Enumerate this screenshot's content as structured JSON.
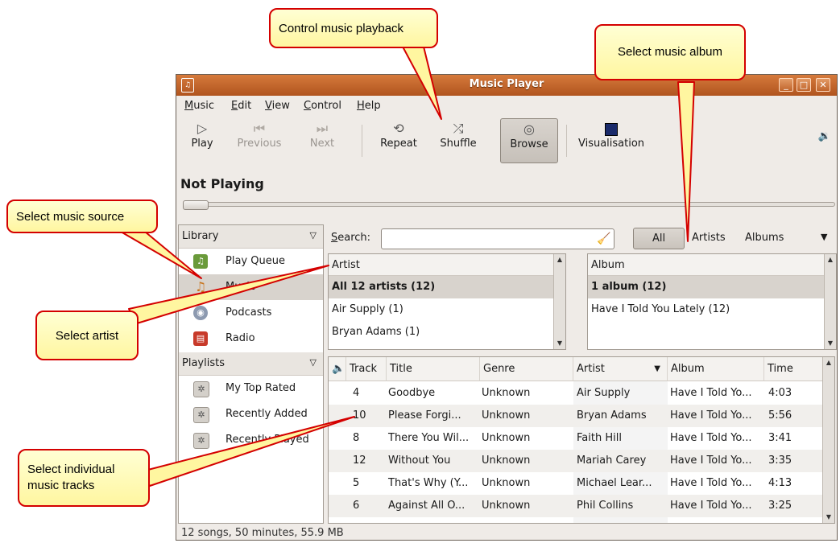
{
  "window": {
    "title": "Music Player"
  },
  "menu": [
    {
      "pre": "",
      "u": "M",
      "post": "usic"
    },
    {
      "pre": "",
      "u": "E",
      "post": "dit"
    },
    {
      "pre": "",
      "u": "V",
      "post": "iew"
    },
    {
      "pre": "",
      "u": "C",
      "post": "ontrol"
    },
    {
      "pre": "",
      "u": "H",
      "post": "elp"
    }
  ],
  "toolbar": {
    "play": "Play",
    "previous": "Previous",
    "next": "Next",
    "repeat": "Repeat",
    "shuffle": "Shuffle",
    "browse": "Browse",
    "visualisation": "Visualisation"
  },
  "now_playing": "Not Playing",
  "sidebar": {
    "library_header": "Library",
    "library_items": [
      {
        "label": "Play Queue",
        "icon": "play-queue-icon"
      },
      {
        "label": "Music",
        "icon": "music-icon"
      },
      {
        "label": "Podcasts",
        "icon": "podcast-icon"
      },
      {
        "label": "Radio",
        "icon": "radio-icon"
      }
    ],
    "playlists_header": "Playlists",
    "playlist_items": [
      {
        "label": "My Top Rated",
        "icon": "gear-icon"
      },
      {
        "label": "Recently Added",
        "icon": "gear-icon"
      },
      {
        "label": "Recently Played",
        "icon": "gear-icon"
      }
    ]
  },
  "search": {
    "label_underlined": "S",
    "label_rest": "earch:",
    "value": ""
  },
  "filters": {
    "all": "All",
    "artists": "Artists",
    "albums": "Albums"
  },
  "artist_pane": {
    "header": "Artist",
    "rows": [
      "All 12 artists (12)",
      "Air Supply (1)",
      "Bryan Adams (1)"
    ]
  },
  "album_pane": {
    "header": "Album",
    "rows": [
      "1 album (12)",
      "Have I Told You Lately (12)"
    ]
  },
  "tracks": {
    "columns": {
      "track": "Track",
      "title": "Title",
      "genre": "Genre",
      "artist": "Artist",
      "album": "Album",
      "time": "Time"
    },
    "rows": [
      {
        "track": "4",
        "title": "Goodbye",
        "genre": "Unknown",
        "artist": "Air Supply",
        "album": "Have I Told Yo...",
        "time": "4:03"
      },
      {
        "track": "10",
        "title": "Please Forgi...",
        "genre": "Unknown",
        "artist": "Bryan Adams",
        "album": "Have I Told Yo...",
        "time": "5:56"
      },
      {
        "track": "8",
        "title": "There You Wil...",
        "genre": "Unknown",
        "artist": "Faith Hill",
        "album": "Have I Told Yo...",
        "time": "3:41"
      },
      {
        "track": "12",
        "title": "Without You",
        "genre": "Unknown",
        "artist": "Mariah Carey",
        "album": "Have I Told Yo...",
        "time": "3:35"
      },
      {
        "track": "5",
        "title": "That's Why (Y...",
        "genre": "Unknown",
        "artist": "Michael Lear...",
        "album": "Have I Told Yo...",
        "time": "4:13"
      },
      {
        "track": "6",
        "title": "Against All O...",
        "genre": "Unknown",
        "artist": "Phil Collins",
        "album": "Have I Told Yo...",
        "time": "3:25"
      }
    ]
  },
  "status": "12 songs, 50 minutes, 55.9 MB",
  "callouts": {
    "playback": "Control music playback",
    "album": "Select music album",
    "source": "Select music source",
    "artist": "Select artist",
    "tracks_line1": "Select individual",
    "tracks_line2": "music tracks"
  },
  "colors": {
    "titlebar": "#c2622a",
    "callout_border": "#d40000",
    "callout_fill": "#fff6a0"
  }
}
